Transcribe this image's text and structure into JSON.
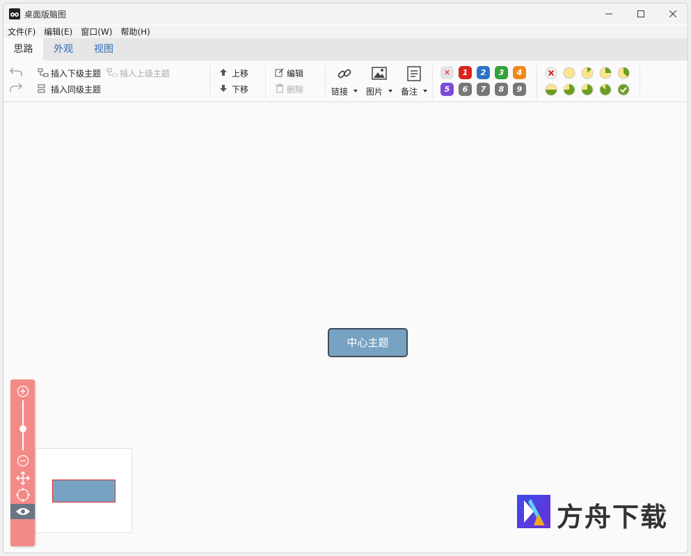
{
  "app": {
    "title": "桌面版脑图"
  },
  "menu": [
    "文件(F)",
    "编辑(E)",
    "窗口(W)",
    "帮助(H)"
  ],
  "tabs": [
    "思路",
    "外观",
    "视图"
  ],
  "toolbar": {
    "insert_child": "插入下级主题",
    "insert_parent": "插入上级主题",
    "insert_sibling": "插入同级主题",
    "move_up": "上移",
    "move_down": "下移",
    "edit": "编辑",
    "delete": "删除",
    "link": "链接",
    "image": "图片",
    "note": "备注"
  },
  "priorities": [
    "1",
    "2",
    "3",
    "4",
    "5",
    "6",
    "7",
    "8",
    "9"
  ],
  "priority_colors": [
    "#d9231d",
    "#2a73c8",
    "#35a13a",
    "#ee8a1c",
    "#7a4bd8",
    "#777777",
    "#777777",
    "#777777",
    "#777777"
  ],
  "progress_levels": [
    "none",
    "0",
    "1/8",
    "2/8",
    "3/8",
    "4/8",
    "5/8",
    "6/8",
    "7/8",
    "done"
  ],
  "canvas": {
    "center_topic": "中心主题"
  },
  "watermark": {
    "text": "方舟下载"
  }
}
